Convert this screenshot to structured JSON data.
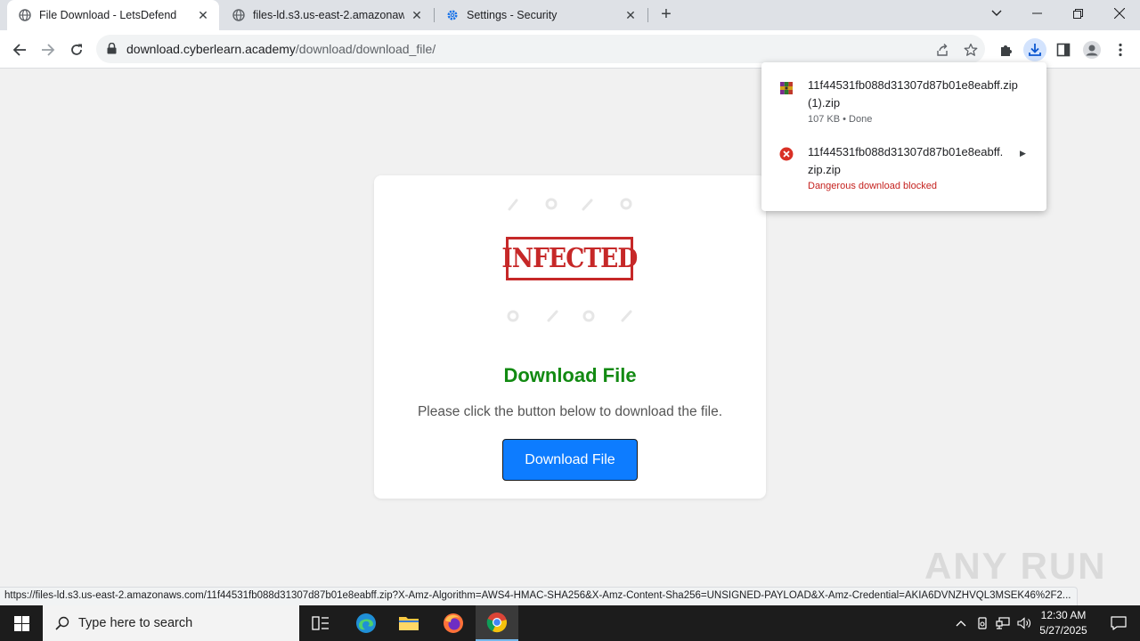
{
  "browser": {
    "tabs": [
      {
        "title": "File Download - LetsDefend",
        "active": true,
        "icon": "globe-icon"
      },
      {
        "title": "files-ld.s3.us-east-2.amazonaws.",
        "active": false,
        "icon": "globe-icon"
      },
      {
        "title": "Settings - Security",
        "active": false,
        "icon": "gear-icon"
      }
    ],
    "address": {
      "host": "download.cyberlearn.academy",
      "path": "/download/download_file/"
    }
  },
  "page": {
    "stamp_text": "INFECTED",
    "title": "Download File",
    "subtitle": "Please click the button below to download the file.",
    "button_label": "Download File",
    "title_color": "#128a12",
    "button_color": "#0d7cff"
  },
  "downloads": {
    "items": [
      {
        "name_line1": "11f44531fb088d31307d87b01e8eabff.zip",
        "name_line2": "(1).zip",
        "status": "107 KB • Done",
        "icon": "archive-icon"
      },
      {
        "name_line1": "11f44531fb088d31307d87b01e8eabff.",
        "name_line2": "zip.zip",
        "status": "Dangerous download blocked",
        "icon": "error-icon"
      }
    ]
  },
  "status_bar": {
    "url": "https://files-ld.s3.us-east-2.amazonaws.com/11f44531fb088d31307d87b01e8eabff.zip?X-Amz-Algorithm=AWS4-HMAC-SHA256&X-Amz-Content-Sha256=UNSIGNED-PAYLOAD&X-Amz-Credential=AKIA6DVNZHVQL3MSEK46%2F2..."
  },
  "watermark": "ANY RUN",
  "taskbar": {
    "search_placeholder": "Type here to search",
    "time": "12:30 AM",
    "date": "5/27/2025"
  }
}
